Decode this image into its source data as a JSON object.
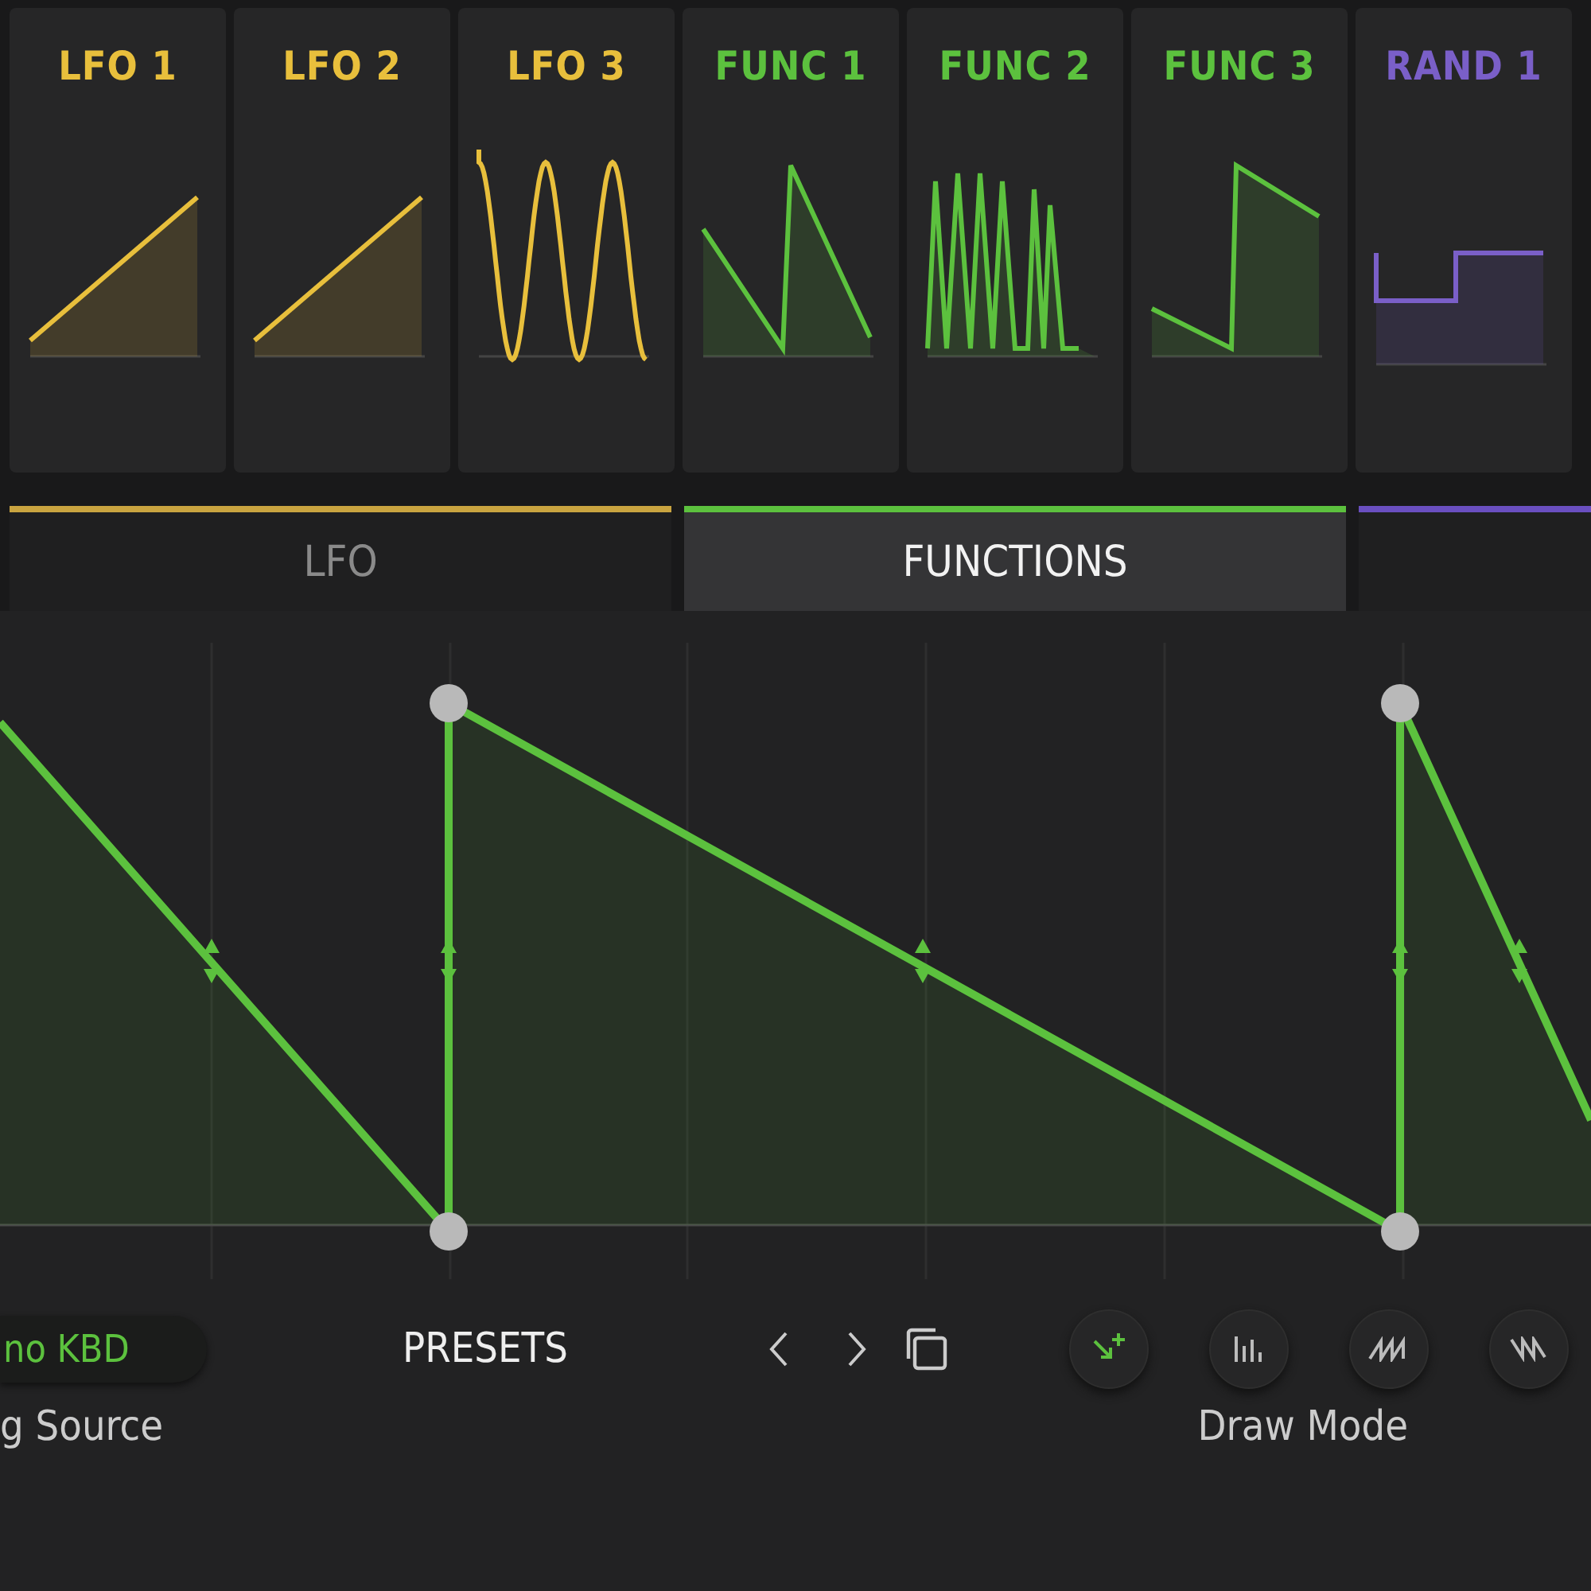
{
  "modulators": [
    {
      "label": "LFO 1",
      "color": "#e8bf3c",
      "kind": "ramp"
    },
    {
      "label": "LFO 2",
      "color": "#e8bf3c",
      "kind": "ramp"
    },
    {
      "label": "LFO 3",
      "color": "#e8bf3c",
      "kind": "sine"
    },
    {
      "label": "FUNC 1",
      "color": "#5cc13e",
      "kind": "saw"
    },
    {
      "label": "FUNC 2",
      "color": "#5cc13e",
      "kind": "saws"
    },
    {
      "label": "FUNC 3",
      "color": "#5cc13e",
      "kind": "jump"
    },
    {
      "label": "RAND 1",
      "color": "#7a5fc8",
      "kind": "step"
    }
  ],
  "tabs": [
    {
      "label": "LFO",
      "color": "#c9a440",
      "selected": false
    },
    {
      "label": "FUNCTIONS",
      "color": "#5cc13e",
      "selected": true
    },
    {
      "color": "#6a4fc0",
      "selected": false
    }
  ],
  "editor": {
    "color": "#5cc13e"
  },
  "source": {
    "value": "no KBD",
    "caption": "g Source"
  },
  "presets": {
    "label": "PRESETS"
  },
  "draw_mode": {
    "caption": "Draw Mode",
    "buttons": [
      {
        "kind": "add",
        "selected": true
      },
      {
        "kind": "bars",
        "selected": false
      },
      {
        "kind": "saw",
        "selected": false
      },
      {
        "kind": "ramp",
        "selected": false
      }
    ]
  }
}
